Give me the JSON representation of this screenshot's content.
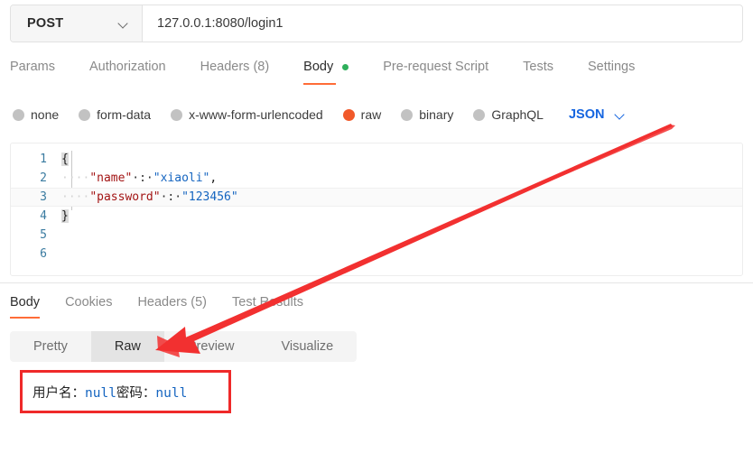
{
  "request": {
    "method": "POST",
    "url": "127.0.0.1:8080/login1",
    "method_chevron_icon": "chevron-down-icon",
    "tabs": [
      {
        "label": "Params",
        "active": false
      },
      {
        "label": "Authorization",
        "active": false
      },
      {
        "label": "Headers (8)",
        "active": false
      },
      {
        "label": "Body",
        "active": true,
        "dot": true
      },
      {
        "label": "Pre-request Script",
        "active": false
      },
      {
        "label": "Tests",
        "active": false
      },
      {
        "label": "Settings",
        "active": false
      }
    ],
    "body_modes": [
      {
        "label": "none",
        "selected": false
      },
      {
        "label": "form-data",
        "selected": false
      },
      {
        "label": "x-www-form-urlencoded",
        "selected": false
      },
      {
        "label": "raw",
        "selected": true
      },
      {
        "label": "binary",
        "selected": false
      },
      {
        "label": "GraphQL",
        "selected": false
      }
    ],
    "format_select": {
      "label": "JSON",
      "chevron_icon": "chevron-down-icon"
    }
  },
  "editor": {
    "lines": [
      {
        "number": "1",
        "segments": [
          {
            "text": "{",
            "type": "brace"
          }
        ]
      },
      {
        "number": "2",
        "segments": [
          {
            "text": "····",
            "type": "ws"
          },
          {
            "text": "\"name\"",
            "type": "key"
          },
          {
            "text": "·:·",
            "type": "colon"
          },
          {
            "text": "\"xiaoli\"",
            "type": "str"
          },
          {
            "text": ",",
            "type": "punc"
          }
        ]
      },
      {
        "number": "3",
        "highlight": true,
        "segments": [
          {
            "text": "····",
            "type": "ws"
          },
          {
            "text": "\"password\"",
            "type": "key"
          },
          {
            "text": "·:·",
            "type": "colon"
          },
          {
            "text": "\"123456\"",
            "type": "str"
          }
        ]
      },
      {
        "number": "4",
        "segments": [
          {
            "text": "}",
            "type": "brace"
          }
        ]
      },
      {
        "number": "5",
        "segments": []
      },
      {
        "number": "6",
        "segments": []
      }
    ]
  },
  "response": {
    "tabs": [
      {
        "label": "Body",
        "active": true
      },
      {
        "label": "Cookies",
        "active": false
      },
      {
        "label": "Headers (5)",
        "active": false
      },
      {
        "label": "Test Results",
        "active": false
      }
    ],
    "view_modes": [
      {
        "label": "Pretty",
        "active": false
      },
      {
        "label": "Raw",
        "active": true
      },
      {
        "label": "Preview",
        "active": false
      },
      {
        "label": "Visualize",
        "active": false
      }
    ],
    "body_text_prefix": "用户名：",
    "body_value_1": "null",
    "body_text_middle": "密码：",
    "body_value_2": "null"
  },
  "annotation": {
    "arrow_color": "#f23030",
    "highlight_box_color": "#ef2929"
  }
}
